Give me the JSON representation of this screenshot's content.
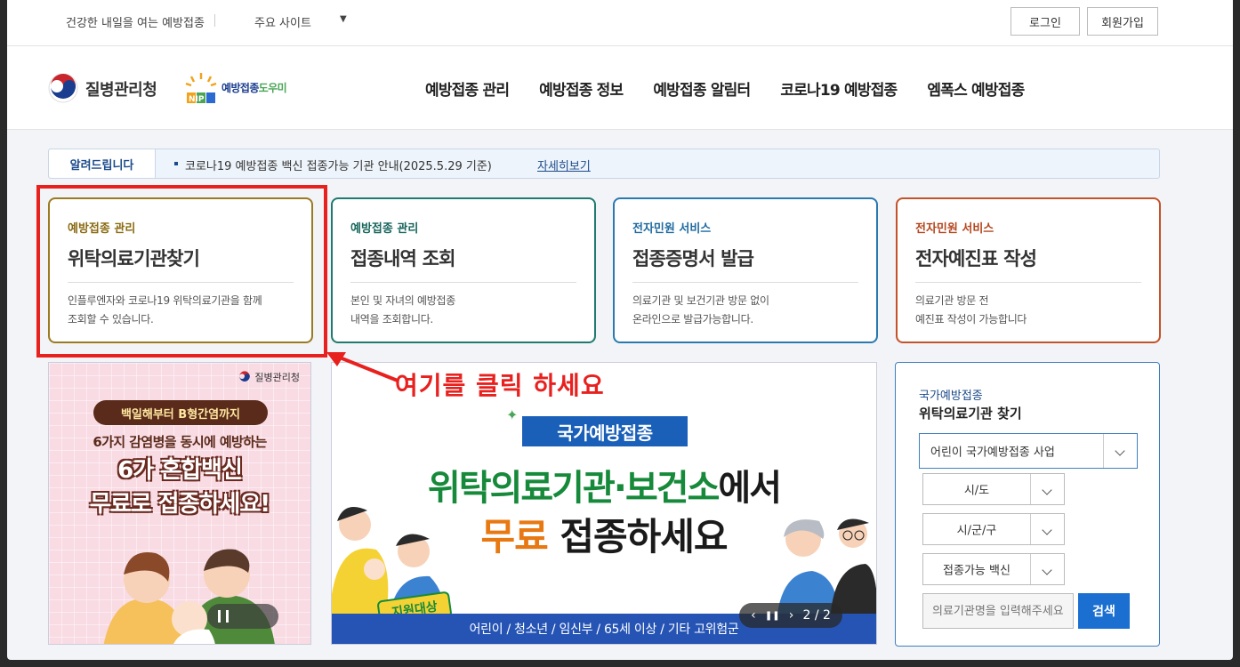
{
  "util": {
    "slogan": "건강한 내일을 여는 예방접종",
    "sites": "주요 사이트",
    "caret": "▼",
    "login": "로그인",
    "join": "회원가입"
  },
  "header": {
    "org": "질병관리청",
    "nip_blue": "예방접종",
    "nip_green": "도우미",
    "nip_letters": "NIP",
    "gnb": [
      "예방접종 관리",
      "예방접종 정보",
      "예방접종 알림터",
      "코로나19 예방접종",
      "엠폭스 예방접종"
    ]
  },
  "notice": {
    "label": "알려드립니다",
    "message": "코로나19 예방접종 백신 접종가능 기관 안내(2025.5.29 기준)",
    "more": "자세히보기"
  },
  "cards": [
    {
      "category": "예방접종 관리",
      "title": "위탁의료기관찾기",
      "desc1": "인플루엔자와 코로나19 위탁의료기관을 함께",
      "desc2": "조회할 수 있습니다.",
      "color": "#9a7a22"
    },
    {
      "category": "예방접종 관리",
      "title": "접종내역 조회",
      "desc1": "본인 및 자녀의 예방접종",
      "desc2": "내역을 조회합니다.",
      "color": "#1f7a70"
    },
    {
      "category": "전자민원 서비스",
      "title": "접종증명서 발급",
      "desc1": "의료기관 및 보건기관 방문 없이",
      "desc2": "온라인으로 발급가능합니다.",
      "color": "#2a7ab0"
    },
    {
      "category": "전자민원 서비스",
      "title": "전자예진표 작성",
      "desc1": "의료기관 방문 전",
      "desc2": "예진표 작성이 가능합니다",
      "color": "#c4532a"
    }
  ],
  "annotation": {
    "text": "여기를 클릭 하세요",
    "color": "#e8201e"
  },
  "banner_left": {
    "org": "질병관리청",
    "pill": "백일해부터 B형간염까지",
    "sub": "6가지 감염병을 동시에 예방하는",
    "big1": "6가 혼합백신",
    "big2": "무료로 접종하세요!"
  },
  "banner_center": {
    "tag": "국가예방접종",
    "line1_green": "위탁의료기관·보건소",
    "line1_rest": "에서",
    "line2_orange": "무료",
    "line2_rest": " 접종하세요",
    "badge": "지원대상",
    "bar": "어린이 / 청소년 / 임신부 / 65세 이상 / 기타 고위험군",
    "prev": "‹",
    "next": "›",
    "pause": "❚❚",
    "page": "2 / 2"
  },
  "search": {
    "category": "국가예방접종",
    "title": "위탁의료기관 찾기",
    "program": "어린이 국가예방접종 사업",
    "sido": "시/도",
    "sigungu": "시/군/구",
    "vaccine": "접종가능 백신",
    "placeholder": "의료기관명을 입력해주세요",
    "button": "검색"
  }
}
